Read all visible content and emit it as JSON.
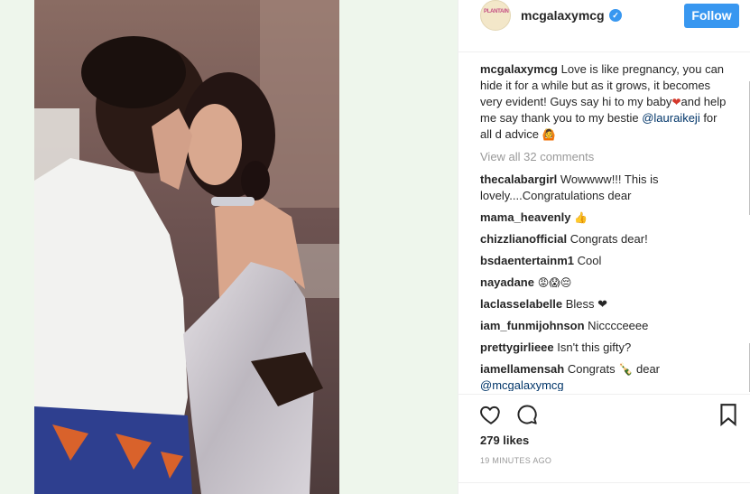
{
  "post": {
    "username": "mcgalaxymcg",
    "avatar_text": "PLANTAIN",
    "verified_icon": "verified-badge-icon",
    "follow_label": "Follow",
    "caption_username": "mcgalaxymcg",
    "caption_text_1": " Love is like pregnancy, you can hide it for a while but as it grows, it becomes very evident! Guys say hi to my baby",
    "caption_text_2": "and help me say thank you to my bestie ",
    "caption_mention": "@lauraikeji",
    "caption_text_3": " for all d advice ",
    "view_all": "View all 32 comments",
    "comments": [
      {
        "username": "thecalabargirl",
        "text": " Wowwww!!! This is lovely....Congratulations dear"
      },
      {
        "username": "mama_heavenly",
        "text": " 👍"
      },
      {
        "username": "chizzlianofficial",
        "text": " Congrats dear!"
      },
      {
        "username": "bsdaentertainm1",
        "text": " Cool"
      },
      {
        "username": "nayadane",
        "text": " 😡😱😔"
      },
      {
        "username": "laclasselabelle",
        "text": " Bless ❤"
      },
      {
        "username": "iam_funmijohnson",
        "text": " Nicccceeee"
      },
      {
        "username": "prettygirlieee",
        "text": " Isn't this gifty?"
      },
      {
        "username": "iamellamensah",
        "text": " Congrats 🍾 dear"
      }
    ],
    "last_mention": "@mcgalaxymcg",
    "likes": "279 likes",
    "timestamp": "19 MINUTES AGO",
    "accent_color": "#3897f0"
  }
}
